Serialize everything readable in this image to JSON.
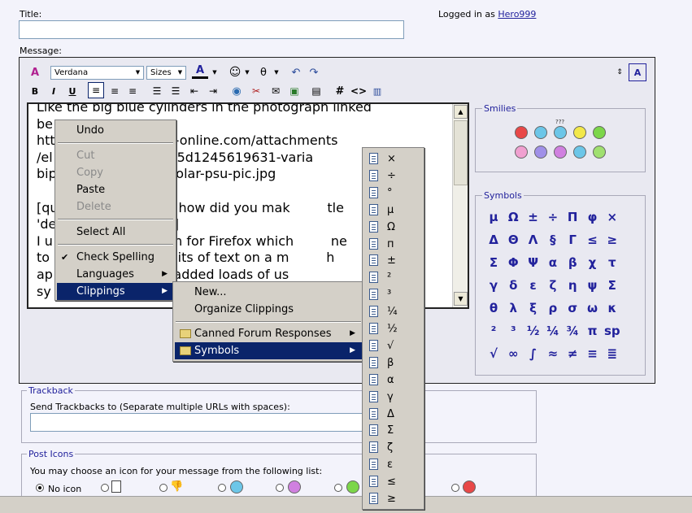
{
  "header": {
    "title_label": "Title:",
    "logged_in_prefix": "Logged in as",
    "username": "Hero999",
    "message_label": "Message:"
  },
  "toolbar": {
    "font_select": "Verdana",
    "size_select": "Sizes",
    "font_color_letter": "A",
    "code_hash": "#",
    "code_tag": "<>"
  },
  "editor": {
    "lines": [
      "Like the big blue cylinders in the photograph linked",
      "be",
      "htt                      tech-online.com/attachments",
      "/el                     /30625d1245619631-varia",
      "bip                     y-bipolar-psu-pic.jpg",
      "",
      "[qu                thing.....how did you mak         tle",
      "'de                [QUOTE]",
      "I u                extension for Firefox which         ne",
      "to                ammed bits of text on a m         h",
      "ap                t click. I added loads of us",
      "sy"
    ]
  },
  "smilies": {
    "legend": "Smilies",
    "row1": [
      {
        "icon": "mad-smiley-icon",
        "color": "#e84848"
      },
      {
        "icon": "smile-smiley-icon",
        "color": "#6cc6e8"
      },
      {
        "icon": "confused-smiley-icon",
        "color": "#6cc6e8"
      },
      {
        "icon": "happy-smiley-icon",
        "color": "#f2e84a"
      },
      {
        "icon": "grin-smiley-icon",
        "color": "#7cd64a"
      }
    ],
    "row2": [
      {
        "icon": "tongue-smiley-icon",
        "color": "#f0a0d0"
      },
      {
        "icon": "frown-smiley-icon",
        "color": "#a090e8"
      },
      {
        "icon": "redface-smiley-icon",
        "color": "#d080e0"
      },
      {
        "icon": "cool-smiley-icon",
        "color": "#6cc6e8"
      },
      {
        "icon": "eek-smiley-icon",
        "color": "#a0e070"
      }
    ],
    "confused_marks": "???"
  },
  "symbols": {
    "legend": "Symbols",
    "rows": [
      [
        "μ",
        "Ω",
        "±",
        "÷",
        "Π",
        "φ",
        "×"
      ],
      [
        "Δ",
        "Θ",
        "Λ",
        "§",
        "Γ",
        "≤",
        "≥"
      ],
      [
        "Σ",
        "Φ",
        "Ψ",
        "α",
        "β",
        "χ",
        "τ"
      ],
      [
        "γ",
        "δ",
        "ε",
        "ζ",
        "η",
        "ψ",
        "Σ"
      ],
      [
        "θ",
        "λ",
        "ξ",
        "ρ",
        "σ",
        "ω",
        "κ"
      ],
      [
        "²",
        "³",
        "½",
        "¼",
        "¾",
        "π",
        "sp"
      ],
      [
        "√",
        "∞",
        "∫",
        "≈",
        "≠",
        "≡",
        "≣"
      ]
    ]
  },
  "context_menu": {
    "items": [
      {
        "label": "Undo",
        "disabled": false
      },
      {
        "label": "Cut",
        "disabled": true
      },
      {
        "label": "Copy",
        "disabled": true
      },
      {
        "label": "Paste",
        "disabled": false
      },
      {
        "label": "Delete",
        "disabled": true
      },
      {
        "label": "Select All",
        "disabled": false
      },
      {
        "label": "Check Spelling",
        "disabled": false,
        "checked": true
      },
      {
        "label": "Languages",
        "disabled": false,
        "submenu": true
      },
      {
        "label": "Clippings",
        "disabled": false,
        "submenu": true,
        "highlighted": true
      }
    ]
  },
  "clippings_menu": {
    "items": [
      {
        "label": "New..."
      },
      {
        "label": "Organize Clippings"
      },
      {
        "label": "Canned Forum Responses",
        "folder": true
      },
      {
        "label": "Symbols",
        "folder": true,
        "highlighted": true
      }
    ]
  },
  "symbols_menu": {
    "items": [
      "×",
      "÷",
      "°",
      "μ",
      "Ω",
      "п",
      "±",
      "²",
      "³",
      "¼",
      "½",
      "√",
      "β",
      "α",
      "γ",
      "Δ",
      "Σ",
      "ζ",
      "ε",
      "≤",
      "≥"
    ]
  },
  "trackback": {
    "legend": "Trackback",
    "label": "Send Trackbacks to (Separate multiple URLs with spaces):"
  },
  "post_icons": {
    "legend": "Post Icons",
    "label": "You may choose an icon for your message from the following list:",
    "no_icon_label": "No icon"
  }
}
